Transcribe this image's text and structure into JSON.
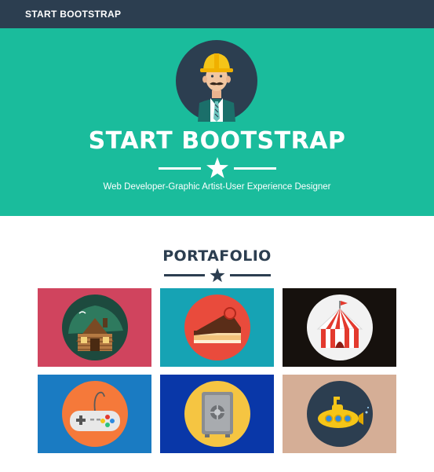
{
  "navbar": {
    "brand": "START BOOTSTRAP"
  },
  "masthead": {
    "title": "START BOOTSTRAP",
    "subtitle": "Web Developer-Graphic Artist-User Experience Designer",
    "icon": "star-icon",
    "avatar_icon": "construction-worker-avatar"
  },
  "portfolio": {
    "title": "PORTAFOLIO",
    "icon": "star-icon",
    "items": [
      {
        "icon": "cabin-icon",
        "bg": "#d0445e"
      },
      {
        "icon": "cake-icon",
        "bg": "#16a3b4"
      },
      {
        "icon": "circus-tent-icon",
        "bg": "#16110d"
      },
      {
        "icon": "game-controller-icon",
        "bg": "#1a7bc2"
      },
      {
        "icon": "safe-icon",
        "bg": "#0937a8"
      },
      {
        "icon": "submarine-icon",
        "bg": "#d5ae96"
      }
    ]
  },
  "colors": {
    "navbar": "#2c3e50",
    "masthead": "#1abc9c",
    "text_dark": "#2c3e50",
    "white": "#ffffff"
  }
}
